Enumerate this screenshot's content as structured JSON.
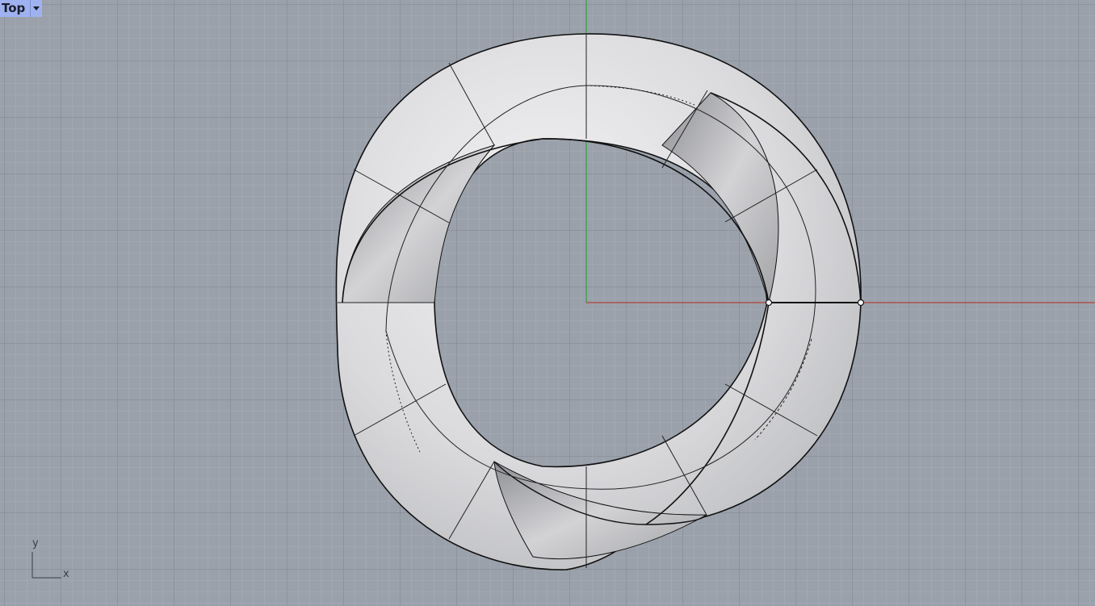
{
  "viewport": {
    "name": "Top",
    "dropdown_icon": "caret-down-icon",
    "background": "#9aa1ab",
    "grid_minor": "#a4aab3",
    "grid_major": "#7f8690",
    "x_axis_color": "#b4443a",
    "y_axis_color": "#2fa33a"
  },
  "axes_widget": {
    "x_label": "x",
    "y_label": "y"
  },
  "object": {
    "type": "twisted torus surface",
    "fill": "#e2e2e4",
    "edge": "#111111"
  }
}
